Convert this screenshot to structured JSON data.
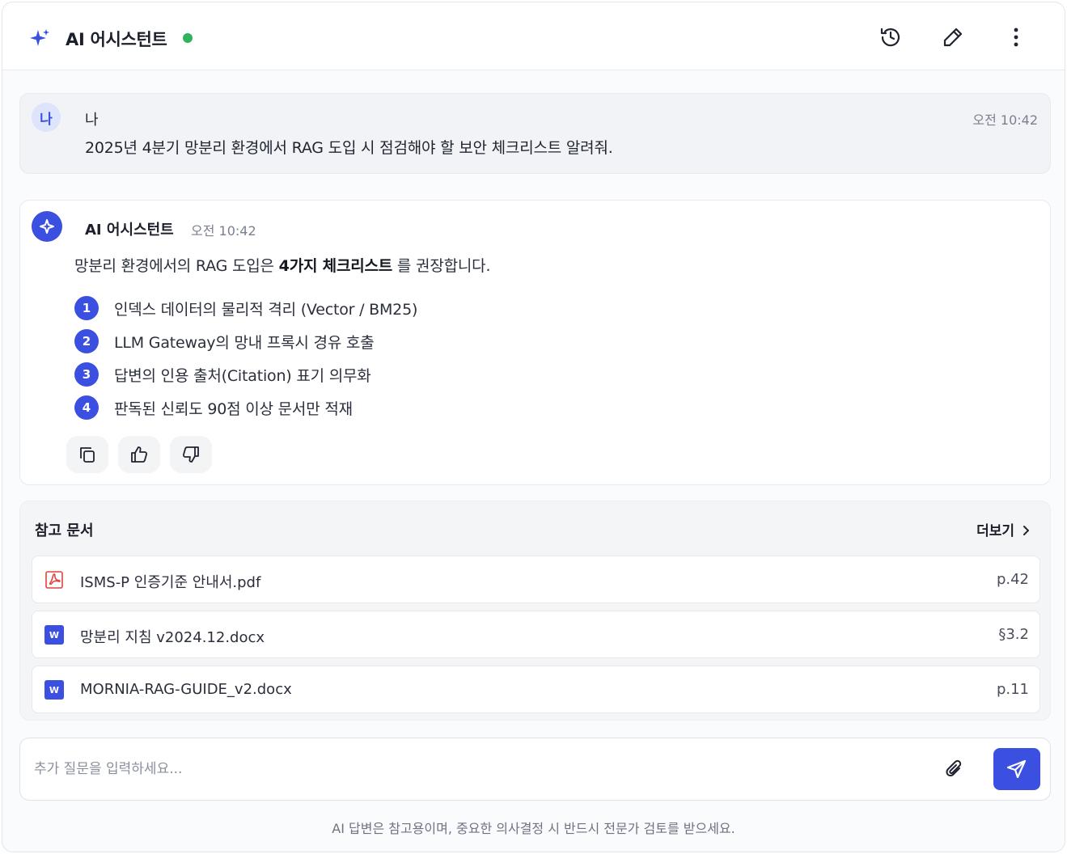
{
  "header": {
    "title": "AI 어시스턴트",
    "status": "online",
    "icons": [
      "sparkle-icon",
      "history-icon",
      "edit-icon",
      "more-vertical-icon"
    ]
  },
  "user_message": {
    "avatar": "나",
    "name": "나",
    "time": "오전 10:42",
    "text": "2025년 4분기 망분리 환경에서 RAG 도입 시 점검해야 할 보안 체크리스트 알려줘."
  },
  "ai_message": {
    "name": "AI 어시스턴트",
    "time": "오전 10:42",
    "intro_before": "망분리 환경에서의 RAG 도입은 ",
    "intro_bold": "4가지 체크리스트",
    "intro_after": " 를 권장합니다.",
    "items": [
      {
        "num": "1",
        "text": "인덱스 데이터의 물리적 격리 (Vector / BM25)"
      },
      {
        "num": "2",
        "text": "LLM Gateway의 망내 프록시 경유 호출"
      },
      {
        "num": "3",
        "text": "답변의 인용 출처(Citation) 표기 의무화"
      },
      {
        "num": "4",
        "text": "판독된 신뢰도 90점 이상 문서만 적재"
      }
    ],
    "actions": [
      "copy-icon",
      "thumbs-up-icon",
      "thumbs-down-icon"
    ]
  },
  "references": {
    "title": "참고 문서",
    "more_label": "더보기",
    "docs": [
      {
        "name": "ISMS-P 인증기준 안내서.pdf",
        "page": "p.42",
        "type": "pdf-icon"
      },
      {
        "name": "망분리 지침 v2024.12.docx",
        "page": "§3.2",
        "type": "word-icon",
        "badge": "W"
      },
      {
        "name": "MORNIA-RAG-GUIDE_v2.docx",
        "page": "p.11",
        "type": "word-icon",
        "badge": "W"
      }
    ]
  },
  "composer": {
    "placeholder": "추가 질문을 입력하세요..."
  },
  "disclaimer": "AI 답변은 참고용이며, 중요한 의사결정 시 반드시 전문가 검토를 받으세요.",
  "colors": {
    "accent": "#3b4fe0",
    "status_online": "#2fb35c",
    "pdf_red": "#e0443a"
  }
}
